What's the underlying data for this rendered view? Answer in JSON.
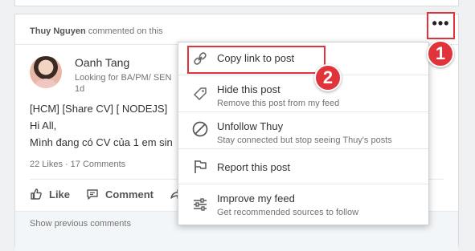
{
  "feed_card": {
    "header": {
      "actor": "Thuy Nguyen",
      "action_text": " commented on this"
    },
    "author": {
      "name": "Oanh Tang",
      "headline": "Looking for BA/PM/ SEN",
      "time": "1d"
    },
    "post_lines": [
      "[HCM] [Share CV] [ NODEJS]",
      "Hi All,",
      "Mình đang có CV của 1 em sin"
    ],
    "stats": {
      "likes": "22 Likes",
      "separator": "·",
      "comments": "17 Comments"
    },
    "actions": {
      "like": "Like",
      "comment": "Comment"
    },
    "show_previous": "Show previous comments"
  },
  "menu": {
    "items": [
      {
        "title": "Copy link to post",
        "subtitle": "",
        "icon": "link-icon"
      },
      {
        "title": "Hide this post",
        "subtitle": "Remove this post from my feed",
        "icon": "tag-icon"
      },
      {
        "title": "Unfollow Thuy",
        "subtitle": "Stay connected but stop seeing Thuy's posts",
        "icon": "block-icon"
      },
      {
        "title": "Report this post",
        "subtitle": "",
        "icon": "flag-icon"
      },
      {
        "title": "Improve my feed",
        "subtitle": "Get recommended sources to follow",
        "icon": "sliders-icon"
      }
    ]
  },
  "annotations": {
    "marker_1": "1",
    "marker_2": "2",
    "color": "#e0333a"
  },
  "colors": {
    "accent_red": "#e0333a",
    "text_primary": "#333333",
    "text_muted": "#737373",
    "feed_bg": "#eef0f2"
  }
}
